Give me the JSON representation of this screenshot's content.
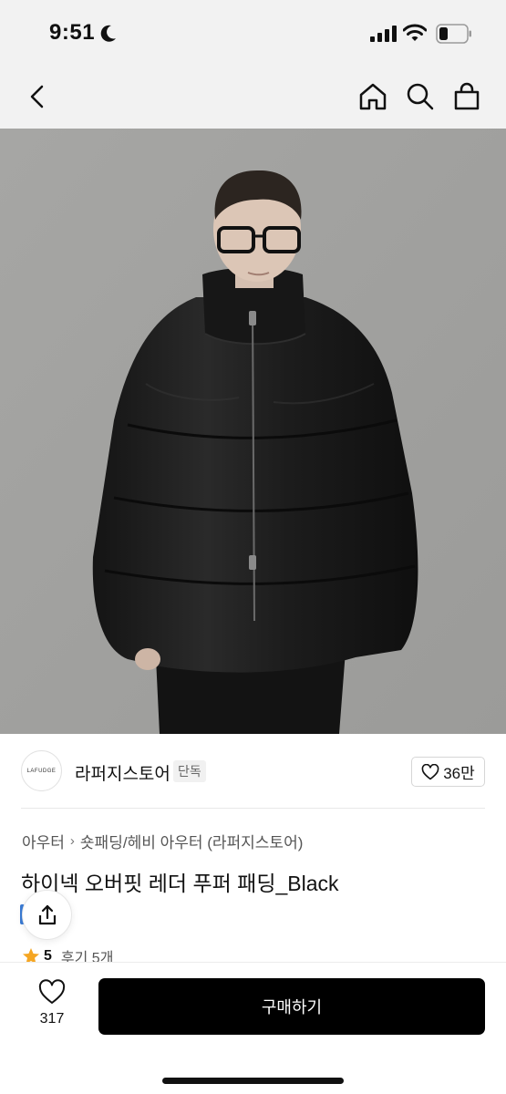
{
  "status_bar": {
    "time": "9:51",
    "icons": [
      "moon-icon",
      "signal-icon",
      "wifi-icon",
      "battery-icon"
    ]
  },
  "nav": {
    "icons": [
      "back-icon",
      "home-icon",
      "search-icon",
      "bag-icon"
    ]
  },
  "store": {
    "logo_text": "LAFUDGE",
    "name": "라퍼지스토어",
    "badge": "단독",
    "like_count": "36만"
  },
  "breadcrumb": {
    "category": "아우터",
    "subcategory": "숏패딩/헤비 아우터 (라퍼지스토어)"
  },
  "product": {
    "title": "하이넥 오버핏 레더 푸퍼 패딩_Black"
  },
  "rating": {
    "score": "5",
    "reviews": "후기 5개"
  },
  "bottom_bar": {
    "wish_count": "317",
    "buy_label": "구매하기"
  },
  "colors": {
    "nav_background": "#f2f2f2",
    "buy_button": "#000000",
    "star": "#f5a623"
  }
}
